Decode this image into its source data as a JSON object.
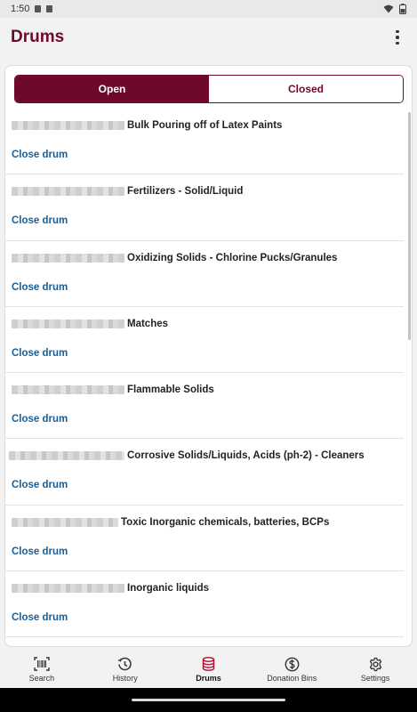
{
  "status": {
    "time": "1:50"
  },
  "app": {
    "title": "Drums"
  },
  "tabs": {
    "open": "Open",
    "closed": "Closed"
  },
  "drums": [
    {
      "name": "Bulk Pouring off of Latex Paints",
      "action": "Close drum"
    },
    {
      "name": "Fertilizers - Solid/Liquid",
      "action": "Close drum"
    },
    {
      "name": "Oxidizing Solids - Chlorine Pucks/Granules",
      "action": "Close drum"
    },
    {
      "name": "Matches",
      "action": "Close drum"
    },
    {
      "name": "Flammable Solids",
      "action": "Close drum"
    },
    {
      "name": "Corrosive Solids/Liquids, Acids (ph-2) - Cleaners",
      "action": "Close drum"
    },
    {
      "name": "Toxic Inorganic chemicals, batteries, BCPs",
      "action": "Close drum"
    },
    {
      "name": "Inorganic liquids",
      "action": "Close drum"
    }
  ],
  "nav": [
    {
      "label": "Search",
      "icon": "barcode-icon"
    },
    {
      "label": "History",
      "icon": "history-icon"
    },
    {
      "label": "Drums",
      "icon": "database-icon"
    },
    {
      "label": "Donation Bins",
      "icon": "dollar-circle-icon"
    },
    {
      "label": "Settings",
      "icon": "gear-icon"
    }
  ],
  "colors": {
    "brand": "#6d0a2a",
    "link": "#1a5e93",
    "active_nav_icon": "#b0102f"
  }
}
